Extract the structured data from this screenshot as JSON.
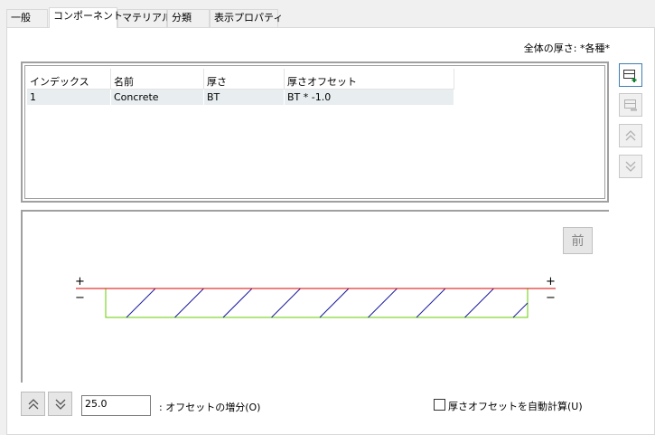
{
  "tabs": [
    {
      "label": "一般",
      "active": false
    },
    {
      "label": "コンポーネント",
      "active": true
    },
    {
      "label": "マテリアル",
      "active": false
    },
    {
      "label": "分類",
      "active": false
    },
    {
      "label": "表示プロパティ",
      "active": false
    }
  ],
  "total_thickness": "全体の厚さ: *各種*",
  "grid": {
    "headers": [
      "インデックス",
      "名前",
      "厚さ",
      "厚さオフセット"
    ],
    "rows": [
      {
        "index": "1",
        "name": "Concrete",
        "thickness": "BT",
        "offset": "BT * -1.0"
      }
    ]
  },
  "side_buttons": [
    {
      "icon": "add-row-icon",
      "enabled": true
    },
    {
      "icon": "remove-row-icon",
      "enabled": false
    },
    {
      "icon": "move-up-icon",
      "enabled": false
    },
    {
      "icon": "move-down-icon",
      "enabled": false
    }
  ],
  "preview": {
    "front_button": "前",
    "plus": "+",
    "minus": "−",
    "colors": {
      "top_line": "#e00000",
      "outline": "#66cc00",
      "hatch": "#1a1aa0"
    }
  },
  "offset_increment": {
    "value": "25.0",
    "label": ": オフセットの増分(O)"
  },
  "auto_calc": {
    "label": "厚さオフセットを自動計算(U)",
    "checked": false
  }
}
